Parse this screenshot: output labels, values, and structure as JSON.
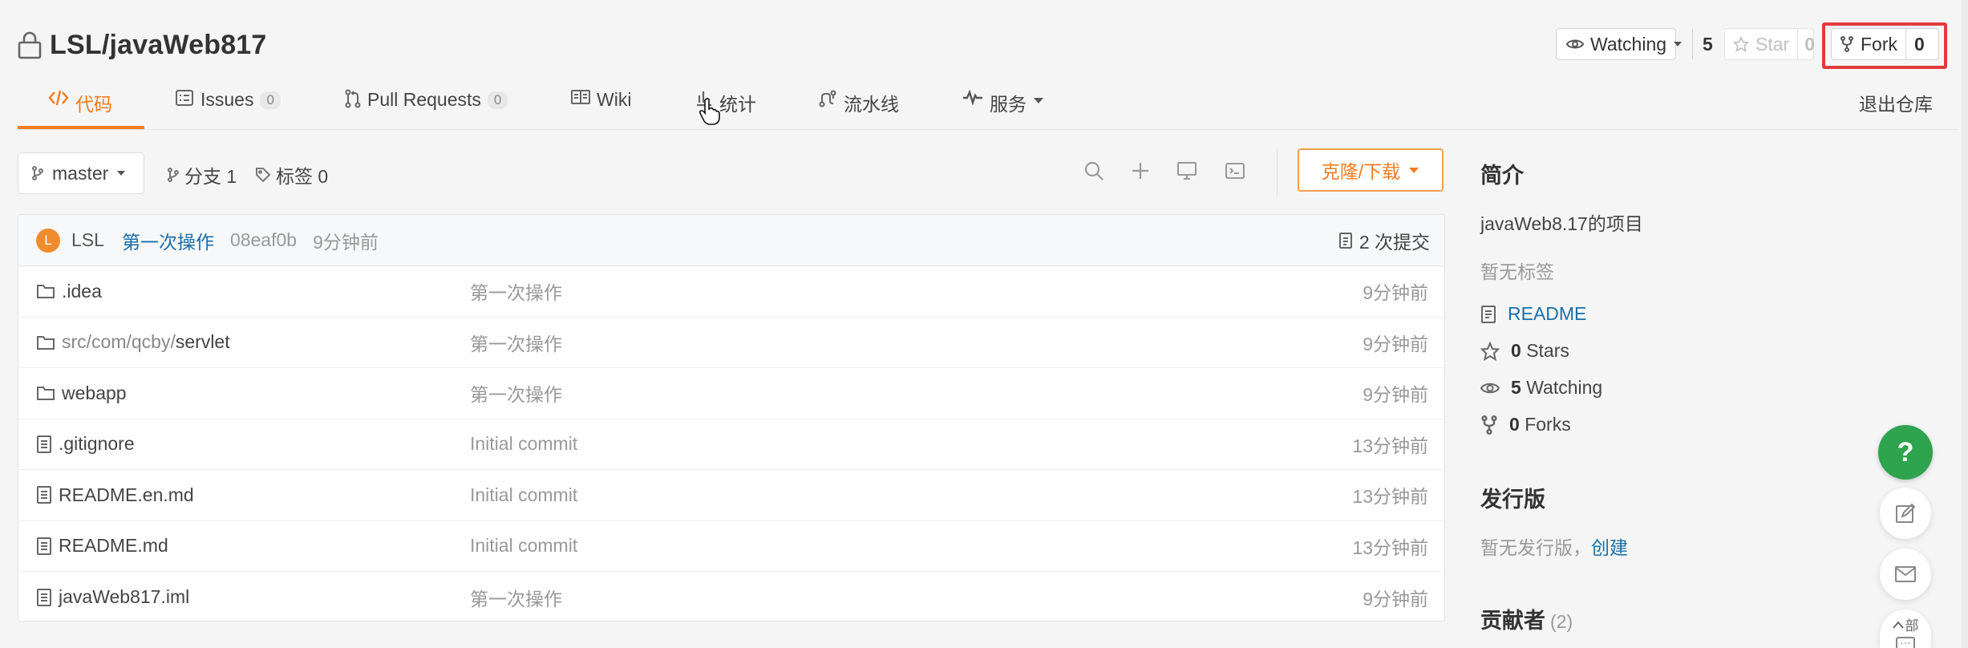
{
  "header": {
    "repo_name": "LSL/javaWeb817",
    "watching": {
      "label": "Watching",
      "count": "5"
    },
    "star": {
      "label": "Star",
      "count": "0"
    },
    "fork": {
      "label": "Fork",
      "count": "0"
    }
  },
  "tabs": [
    {
      "label": "代码",
      "badge": ""
    },
    {
      "label": "Issues",
      "badge": "0"
    },
    {
      "label": "Pull Requests",
      "badge": "0"
    },
    {
      "label": "Wiki",
      "badge": ""
    },
    {
      "label": "统计",
      "badge": ""
    },
    {
      "label": "流水线",
      "badge": ""
    },
    {
      "label": "服务",
      "badge": ""
    }
  ],
  "quit_repo": "退出仓库",
  "toolbar": {
    "branch": "master",
    "branches": "分支 1",
    "tags": "标签 0",
    "clone": "克隆/下载"
  },
  "commit": {
    "avatar_letter": "L",
    "author": "LSL",
    "message": "第一次操作",
    "sha": "08eaf0b",
    "time": "9分钟前",
    "count": "2 次提交"
  },
  "files": [
    {
      "type": "folder",
      "name_dim": "",
      "name": ".idea",
      "message": "第一次操作",
      "time": "9分钟前"
    },
    {
      "type": "folder",
      "name_dim": "src/com/qcby/",
      "name": "servlet",
      "message": "第一次操作",
      "time": "9分钟前"
    },
    {
      "type": "folder",
      "name_dim": "",
      "name": "webapp",
      "message": "第一次操作",
      "time": "9分钟前"
    },
    {
      "type": "file",
      "name_dim": "",
      "name": ".gitignore",
      "message": "Initial commit",
      "time": "13分钟前"
    },
    {
      "type": "file",
      "name_dim": "",
      "name": "README.en.md",
      "message": "Initial commit",
      "time": "13分钟前"
    },
    {
      "type": "file",
      "name_dim": "",
      "name": "README.md",
      "message": "Initial commit",
      "time": "13分钟前"
    },
    {
      "type": "file",
      "name_dim": "",
      "name": "javaWeb817.iml",
      "message": "第一次操作",
      "time": "9分钟前"
    }
  ],
  "sidebar": {
    "intro_title": "简介",
    "description": "javaWeb8.17的项目",
    "no_tags": "暂无标签",
    "readme": "README",
    "stars_count": "0",
    "stars_label": "Stars",
    "watching_count": "5",
    "watching_label": "Watching",
    "forks_count": "0",
    "forks_label": "Forks",
    "release_title": "发行版",
    "no_release": "暂无发行版，",
    "create": "创建",
    "contributors_title": "贡献者",
    "contributors_count": "(2)"
  },
  "floating": {
    "help": "?",
    "expand": "部"
  },
  "colors": {
    "accent": "#f37b1d",
    "link": "#1a6fa8",
    "highlight": "#e23b3b",
    "help": "#2ea44f"
  }
}
